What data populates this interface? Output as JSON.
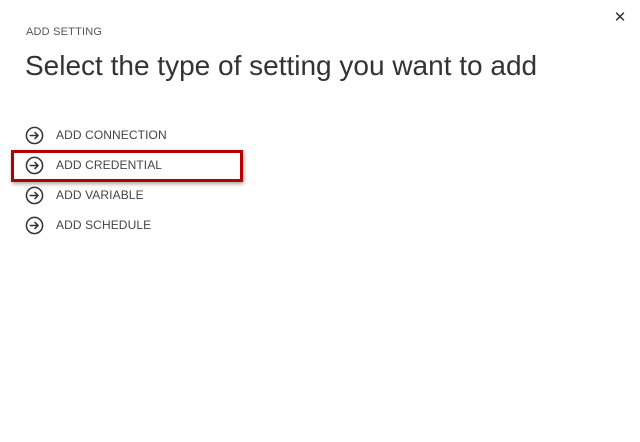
{
  "dialog": {
    "eyebrow": "ADD SETTING",
    "title": "Select the type of setting you want to add",
    "close_icon": "close-icon"
  },
  "options": [
    {
      "label": "ADD CONNECTION",
      "icon": "arrow-circle-right-icon"
    },
    {
      "label": "ADD CREDENTIAL",
      "icon": "arrow-circle-right-icon",
      "highlighted": true
    },
    {
      "label": "ADD VARIABLE",
      "icon": "arrow-circle-right-icon"
    },
    {
      "label": "ADD SCHEDULE",
      "icon": "arrow-circle-right-icon"
    }
  ],
  "colors": {
    "highlight_border": "#b30000",
    "text": "#444444",
    "title": "#333333"
  }
}
